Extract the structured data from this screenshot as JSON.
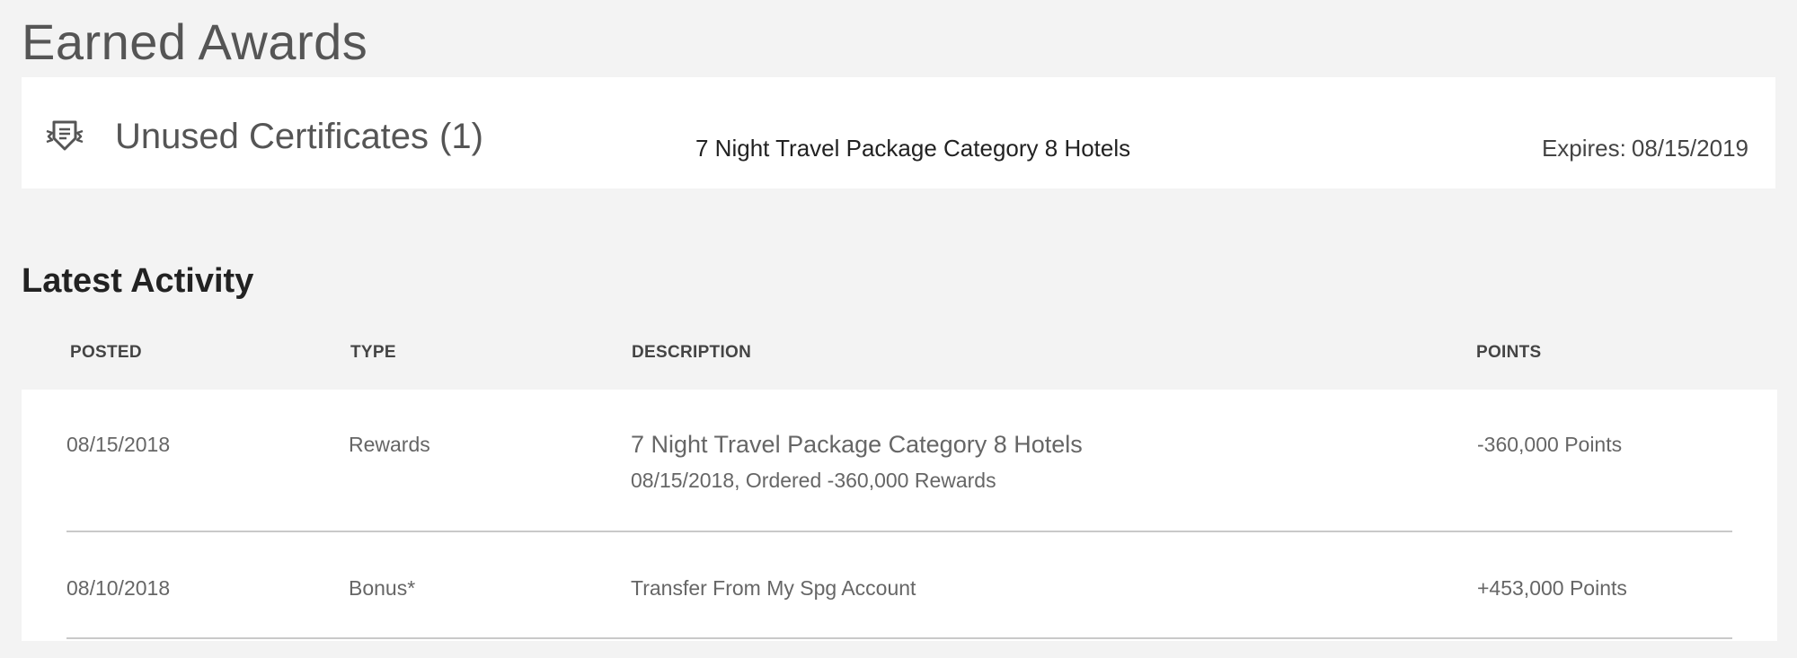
{
  "earned_awards": {
    "title": "Earned Awards",
    "certificate": {
      "icon": "certificate-badge-icon",
      "heading": "Unused Certificates",
      "count": "(1)",
      "name": "7 Night Travel Package Category 8 Hotels",
      "expires_label": "Expires:",
      "expires_date": "08/15/2019"
    }
  },
  "latest_activity": {
    "title": "Latest Activity",
    "columns": {
      "posted": "POSTED",
      "type": "TYPE",
      "description": "DESCRIPTION",
      "points": "POINTS"
    },
    "rows": [
      {
        "posted": "08/15/2018",
        "type": "Rewards",
        "description": "7 Night Travel Package Category 8 Hotels",
        "detail": "08/15/2018, Ordered -360,000 Rewards",
        "points": "-360,000 Points"
      },
      {
        "posted": "08/10/2018",
        "type": "Bonus*",
        "description": "Transfer From My Spg Account",
        "points": "+453,000 Points"
      }
    ]
  },
  "colors": {
    "background": "#f3f3f3",
    "card": "#ffffff",
    "text_dark": "#222222",
    "text_muted": "#666666",
    "divider": "#c9c9c9"
  }
}
